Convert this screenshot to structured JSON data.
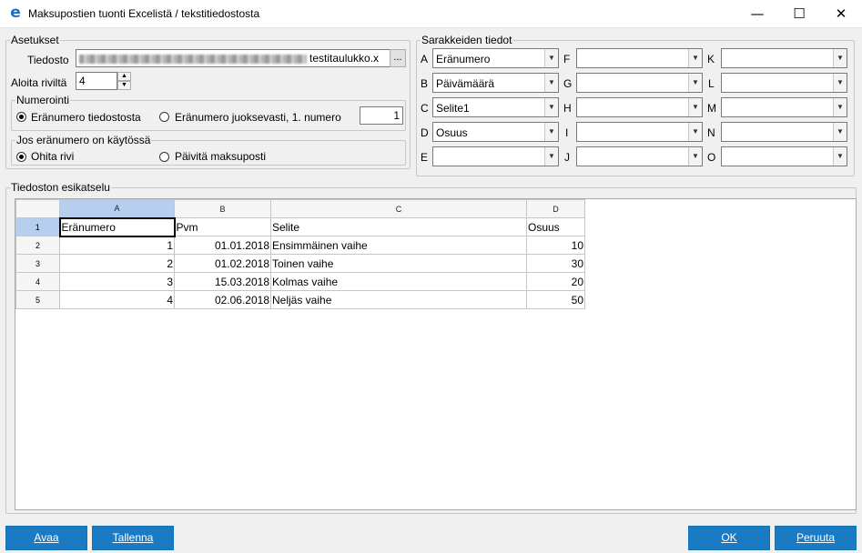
{
  "window": {
    "title": "Maksupostien tuonti Excelistä / tekstitiedostosta",
    "min_glyph": "—",
    "max_glyph": "☐",
    "close_glyph": "✕",
    "icon": "app-e-icon"
  },
  "settings": {
    "legend": "Asetukset",
    "file_label": "Tiedosto",
    "file_value": "testitaulukko.x",
    "browse_label": "...",
    "start_row_label": "Aloita riviltä",
    "start_row_value": "4",
    "numbering": {
      "legend": "Numerointi",
      "opt1": "Eränumero tiedostosta",
      "opt2": "Eränumero juoksevasti, 1. numero",
      "first_number": "1"
    },
    "exists": {
      "legend": "Jos eränumero on käytössä",
      "opt1": "Ohita rivi",
      "opt2": "Päivitä maksuposti"
    }
  },
  "columns": {
    "legend": "Sarakkeiden tiedot",
    "labels": [
      "A",
      "B",
      "C",
      "D",
      "E",
      "F",
      "G",
      "H",
      "I",
      "J",
      "K",
      "L",
      "M",
      "N",
      "O"
    ],
    "values": [
      "Eränumero",
      "Päivämäärä",
      "Selite1",
      "Osuus",
      "",
      "",
      "",
      "",
      "",
      "",
      "",
      "",
      "",
      "",
      ""
    ]
  },
  "preview": {
    "legend": "Tiedoston esikatselu",
    "col_headers": [
      "A",
      "B",
      "C",
      "D"
    ],
    "row_headers": [
      "1",
      "2",
      "3",
      "4",
      "5"
    ],
    "rows": [
      [
        "Eränumero",
        "Pvm",
        "Selite",
        "Osuus"
      ],
      [
        "1",
        "01.01.2018",
        "Ensimmäinen vaihe",
        "10"
      ],
      [
        "2",
        "01.02.2018",
        "Toinen vaihe",
        "30"
      ],
      [
        "3",
        "15.03.2018",
        "Kolmas vaihe",
        "20"
      ],
      [
        "4",
        "02.06.2018",
        "Neljäs vaihe",
        "50"
      ]
    ]
  },
  "buttons": {
    "open": "Avaa",
    "save": "Tallenna",
    "ok": "OK",
    "cancel": "Peruuta"
  },
  "colors": {
    "accent": "#1a7bc4",
    "selected_header": "#b7cfef"
  }
}
